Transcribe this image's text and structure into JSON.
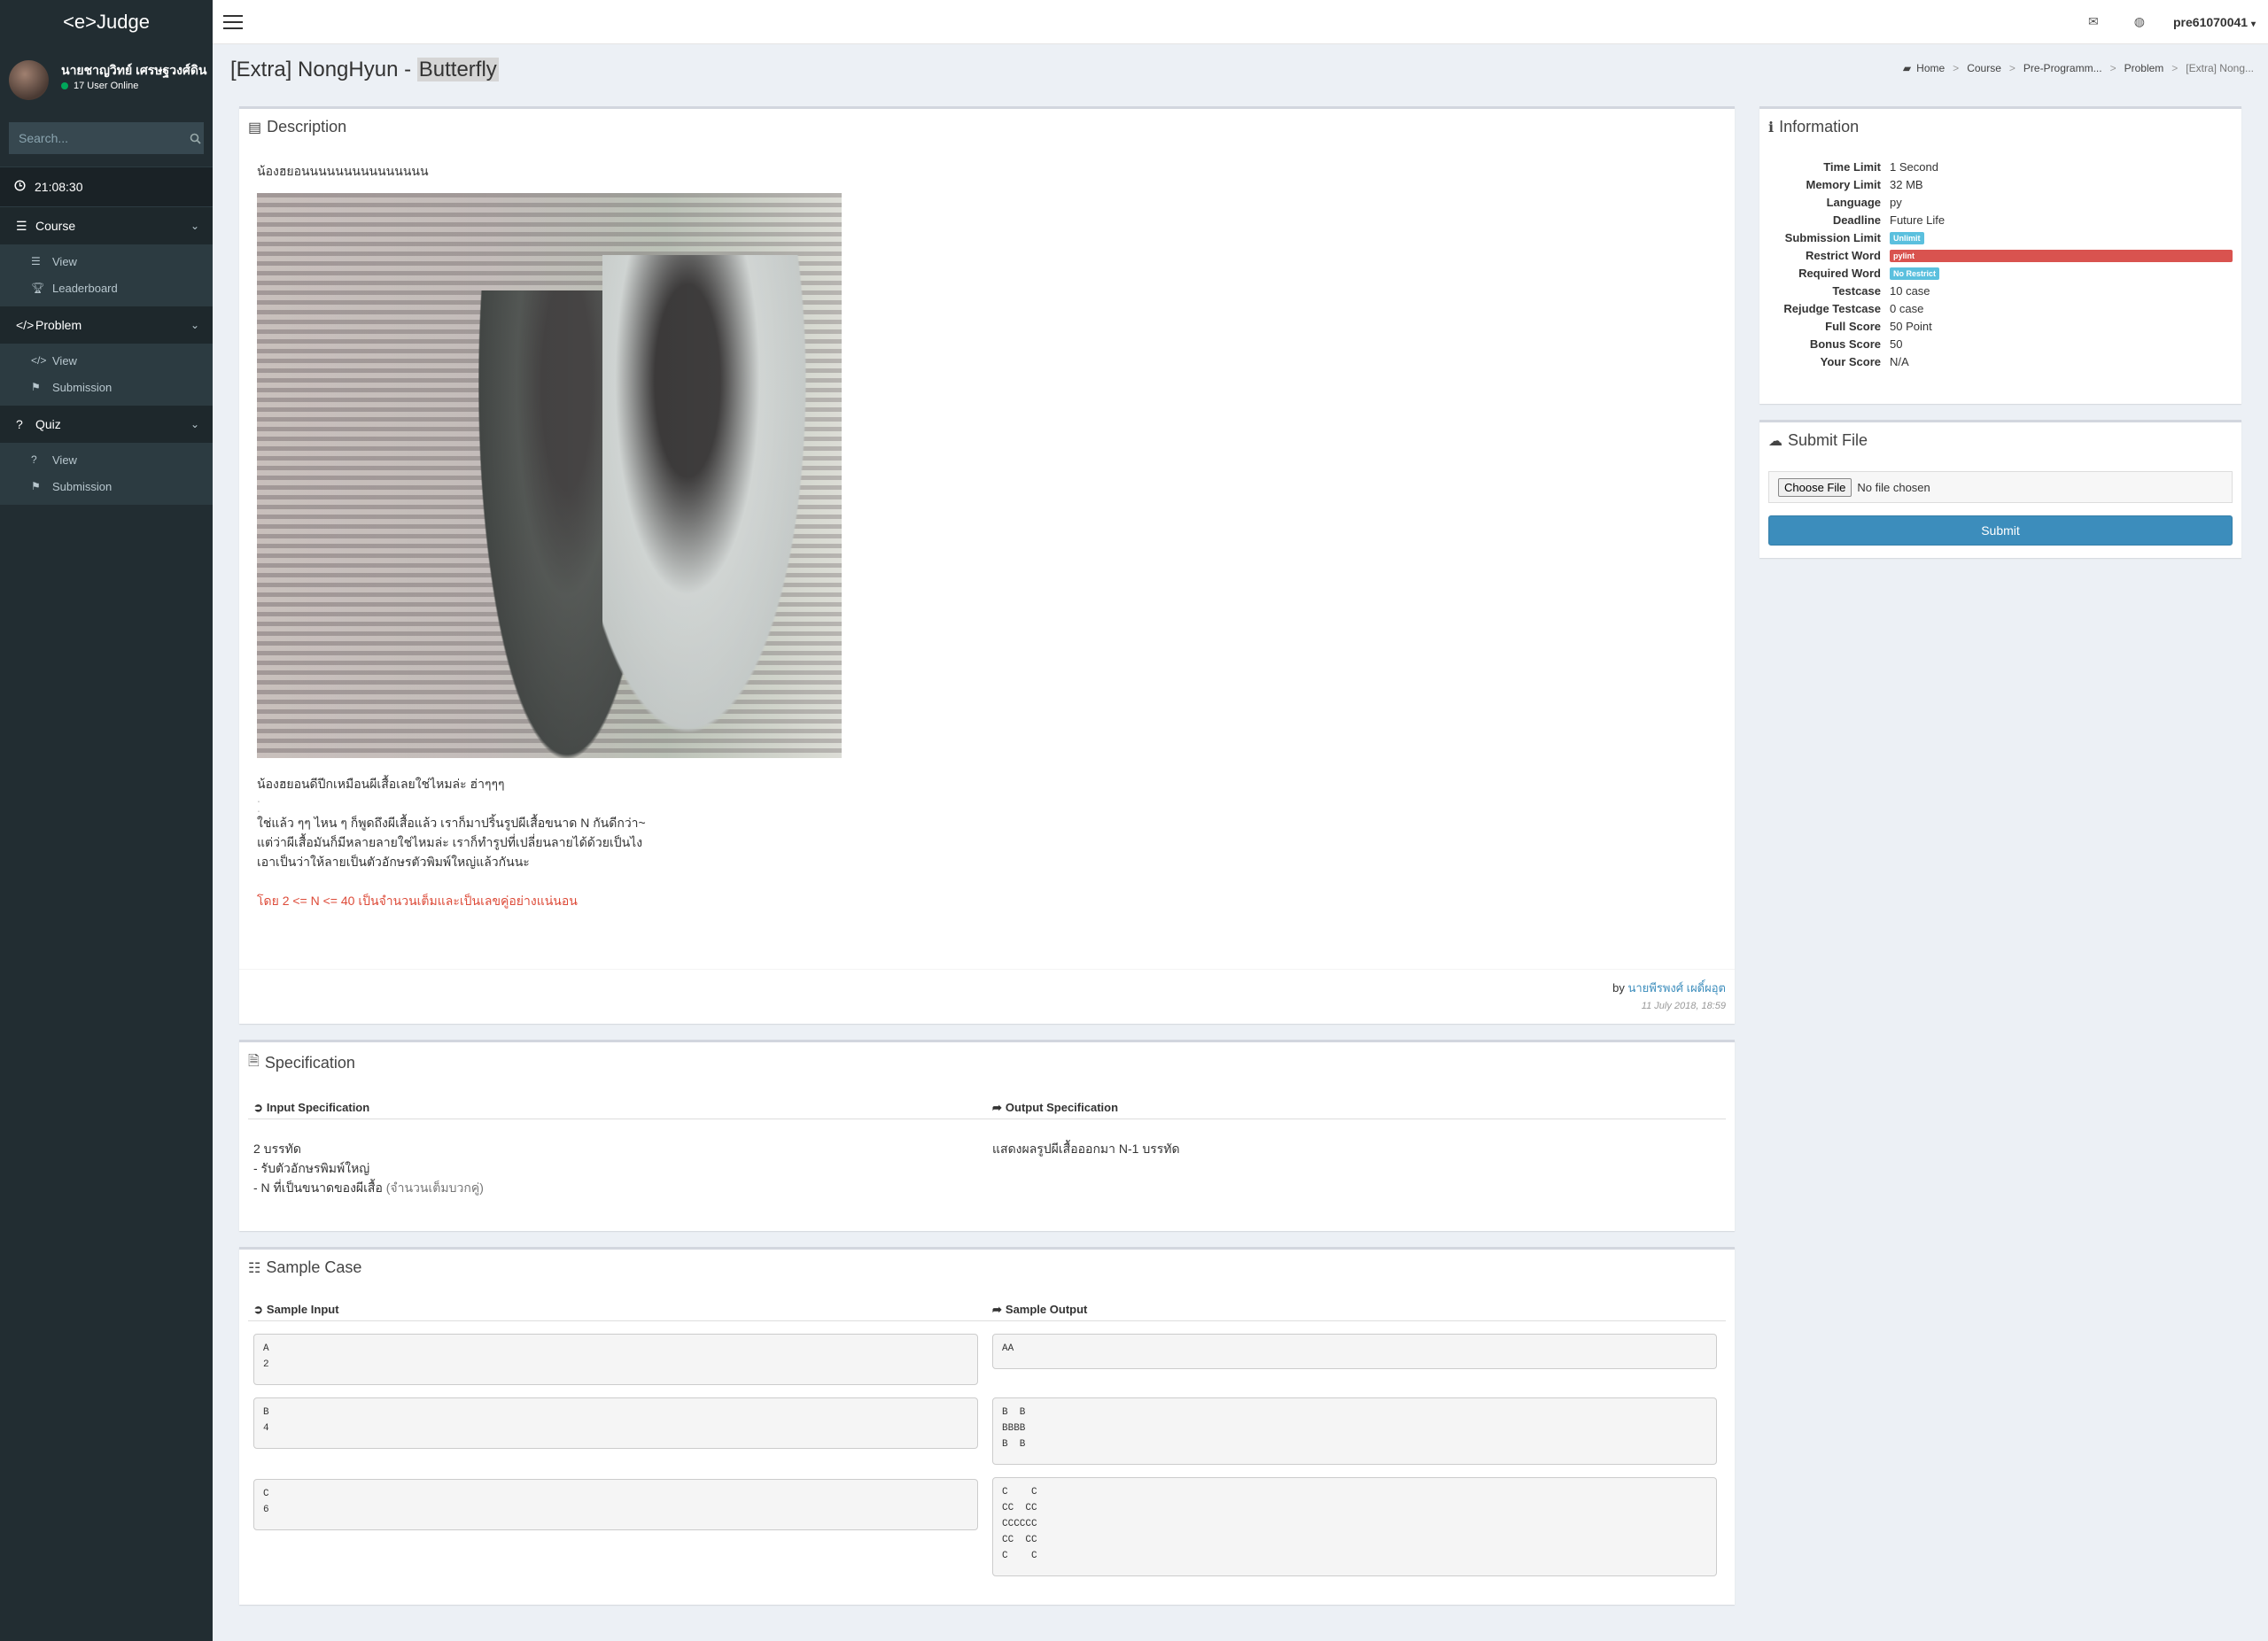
{
  "brand": "<e>Judge",
  "user": {
    "name": "นายชาญวิทย์ เศรษฐวงศ์ดิน",
    "online": "17 User Online"
  },
  "search": {
    "placeholder": "Search..."
  },
  "clock": "21:08:30",
  "menu": {
    "course": {
      "label": "Course",
      "items": [
        "View",
        "Leaderboard"
      ]
    },
    "problem": {
      "label": "Problem",
      "items": [
        "View",
        "Submission"
      ]
    },
    "quiz": {
      "label": "Quiz",
      "items": [
        "View",
        "Submission"
      ]
    }
  },
  "topbar": {
    "username": "pre61070041"
  },
  "page": {
    "title_prefix": "[Extra] NongHyun - ",
    "title_highlight": "Butterfly"
  },
  "breadcrumb": [
    "Home",
    "Course",
    "Pre-Programm...",
    "Problem",
    "[Extra] Nong..."
  ],
  "description": {
    "title": "Description",
    "intro": "น้องฮยอนนนนนนนนนนนนนนน",
    "line1": "น้องฮยอนดีปีกเหมือนผีเสื้อเลยใช่ไหมล่ะ  ฮ่าๆๆๆ",
    "line2": "ใช่แล้ว ๆๆ ไหน ๆ ก็พูดถึงผีเสื้อแล้ว เราก็มาปริ้นรูปผีเสื้อขนาด N กันดีกว่า~",
    "line3": "แต่ว่าผีเสื้อมันก็มีหลายลายใช่ไหมล่ะ เราก็ทำรูปที่เปลี่ยนลายได้ด้วยเป็นไง",
    "line4": "เอาเป็นว่าให้ลายเป็นตัวอักษรตัวพิมพ์ใหญ่แล้วกันนะ",
    "constraint": "โดย 2 <= N <= 40 เป็นจำนวนเต็มและเป็นเลขคู่อย่างแน่นอน",
    "by_label": "by ",
    "author": "นายพีรพงศ์ เผดิ์ผอุต",
    "date": "11 July 2018, 18:59"
  },
  "specification": {
    "title": "Specification",
    "input_head": "Input Specification",
    "output_head": "Output Specification",
    "input_lines": [
      "2 บรรทัด",
      "- รับตัวอักษรพิมพ์ใหญ่",
      "- N ที่เป็นขนาดของผีเสื้อ"
    ],
    "input_note": "(จำนวนเต็มบวกคู่)",
    "output_text": "แสดงผลรูปผีเสื้อออกมา N-1 บรรทัด"
  },
  "sample": {
    "title": "Sample Case",
    "input_head": "Sample Input",
    "output_head": "Sample Output",
    "cases": [
      {
        "input": "A\n2",
        "output": "AA"
      },
      {
        "input": "B\n4",
        "output": "B  B\nBBBB\nB  B"
      },
      {
        "input": "C\n6",
        "output": "C    C\nCC  CC\nCCCCCC\nCC  CC\nC    C"
      }
    ]
  },
  "information": {
    "title": "Information",
    "rows": [
      {
        "k": "Time Limit",
        "v": "1 Second"
      },
      {
        "k": "Memory Limit",
        "v": "32 MB"
      },
      {
        "k": "Language",
        "v": "py"
      },
      {
        "k": "Deadline",
        "v": "Future Life"
      },
      {
        "k": "Submission Limit",
        "badge": "Unlimit",
        "style": "info"
      },
      {
        "k": "Restrict Word",
        "badge": "pylint",
        "style": "danger"
      },
      {
        "k": "Required Word",
        "badge": "No Restrict",
        "style": "info"
      },
      {
        "k": "Testcase",
        "v": "10 case"
      },
      {
        "k": "Rejudge Testcase",
        "v": "0 case"
      },
      {
        "k": "Full Score",
        "v": "50 Point"
      },
      {
        "k": "Bonus Score",
        "v": "50"
      },
      {
        "k": "Your Score",
        "v": "N/A"
      }
    ]
  },
  "submit": {
    "title": "Submit File",
    "choose_label": "Choose File",
    "no_file": "No file chosen",
    "button": "Submit"
  },
  "colors": {
    "sidebar": "#222d32",
    "primary": "#3c8dbc",
    "danger": "#d9534f",
    "info": "#5bc0de",
    "constraint": "#dd4b39"
  }
}
